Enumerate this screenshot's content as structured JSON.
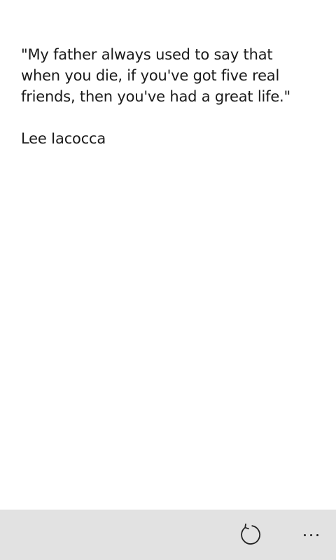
{
  "quote": {
    "text": "\"My father always used to say that when you die, if you've got five real friends, then you've had a great life.\"",
    "author": "Lee Iacocca"
  },
  "app_bar": {
    "buttons": [
      {
        "icon": "refresh-icon"
      },
      {
        "icon": "more-options-icon"
      }
    ]
  }
}
